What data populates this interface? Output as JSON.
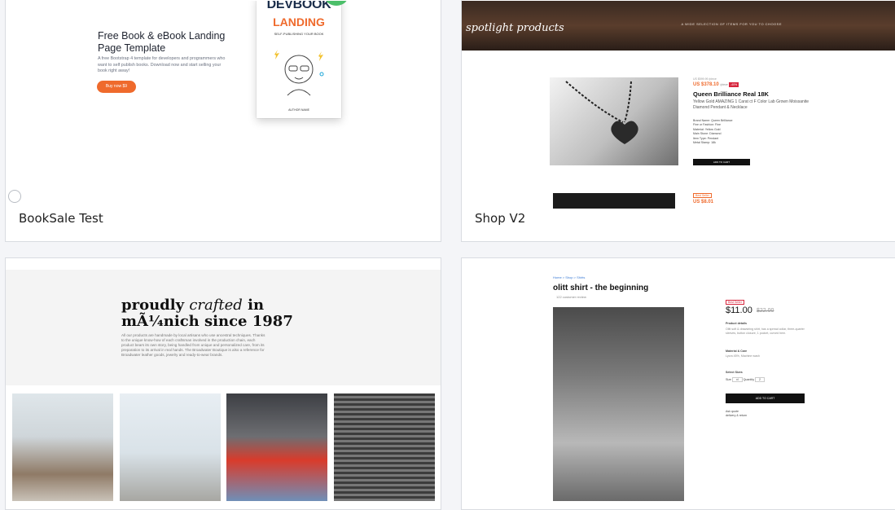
{
  "cards": [
    {
      "name": "BookSale Test",
      "thumb": {
        "title": "Free Book & eBook Landing Page Template",
        "desc": "A free Bootstrap 4 template for developers and programmers who want to self publish books. Download now and start selling your book right away!",
        "button": "Buy now $9",
        "book_line1": "DEVBOOK",
        "book_line2": "LANDING",
        "book_line3": "SELF-PUBLISHING YOUR BOOK",
        "author": "AUTHOR NAME"
      }
    },
    {
      "name": "Shop V2",
      "thumb": {
        "hero_title": "spotlight products",
        "hero_sub": "A WIDE SELECTION OF ITEMS FOR YOU TO CHOOSE",
        "price_old": "US $599.99 /piece",
        "price_new": "US $378.10",
        "price_unit": "/piece",
        "sale": "-40%",
        "product_name": "Queen Brilliance Real 18K",
        "product_desc": "Yellow Gold AMAZING 1 Carat ct F Color Lab Grown Moissanite Diamond Pendant & Necklace",
        "specs": [
          "Brand Name: Queen Brilliance",
          "Fine or Fashion: Fine",
          "Material: Yellow Gold",
          "Main Stone: Diamond",
          "Item Type: Pendant",
          "Metal Stamp: 18k"
        ],
        "cart_label": "ADD TO CART",
        "tag2": "Best Seller",
        "price2": "US $8.01"
      }
    },
    {
      "name": "",
      "thumb": {
        "title_a": "proudly",
        "title_b": "crafted",
        "title_c": "in",
        "title_d": "mÃ¼nich since 1987",
        "desc": "All our products are handmade by local artisans who use ancestral techniques. Thanks to the unique know-how of each craftsman involved in the production chain, each product bears its own story, being handled from unique and personalized care, from its preparation to its arrival in real hands. The Broadwater Boutique is also a reference for Broadwater leather goods, jewelry and ready-to-wear brands."
      }
    },
    {
      "name": "",
      "thumb": {
        "breadcrumb": "Home  >  Shop  >  Shirts",
        "title": "olitt shirt - the beginning",
        "reviews": "122 customer review",
        "stock": "Best Seller",
        "price": "$11.00",
        "old_price": "$22.00",
        "details_title": "Product details",
        "details": "Olitt soft & drawstring shirt, has a spread collar, three-quarter sleeves, button closure, 1 pocket, curved hem.",
        "care_title": "Material & Care",
        "care": "Lycra 45%, Machine wash",
        "size_title": "Select Sizes",
        "size_label": "Size",
        "size_value": "xl",
        "qty_label": "Quantity",
        "qty_value": "2",
        "cart": "ADD TO CART",
        "extra1": "Ask quote",
        "extra2": "delivery & return"
      }
    }
  ]
}
